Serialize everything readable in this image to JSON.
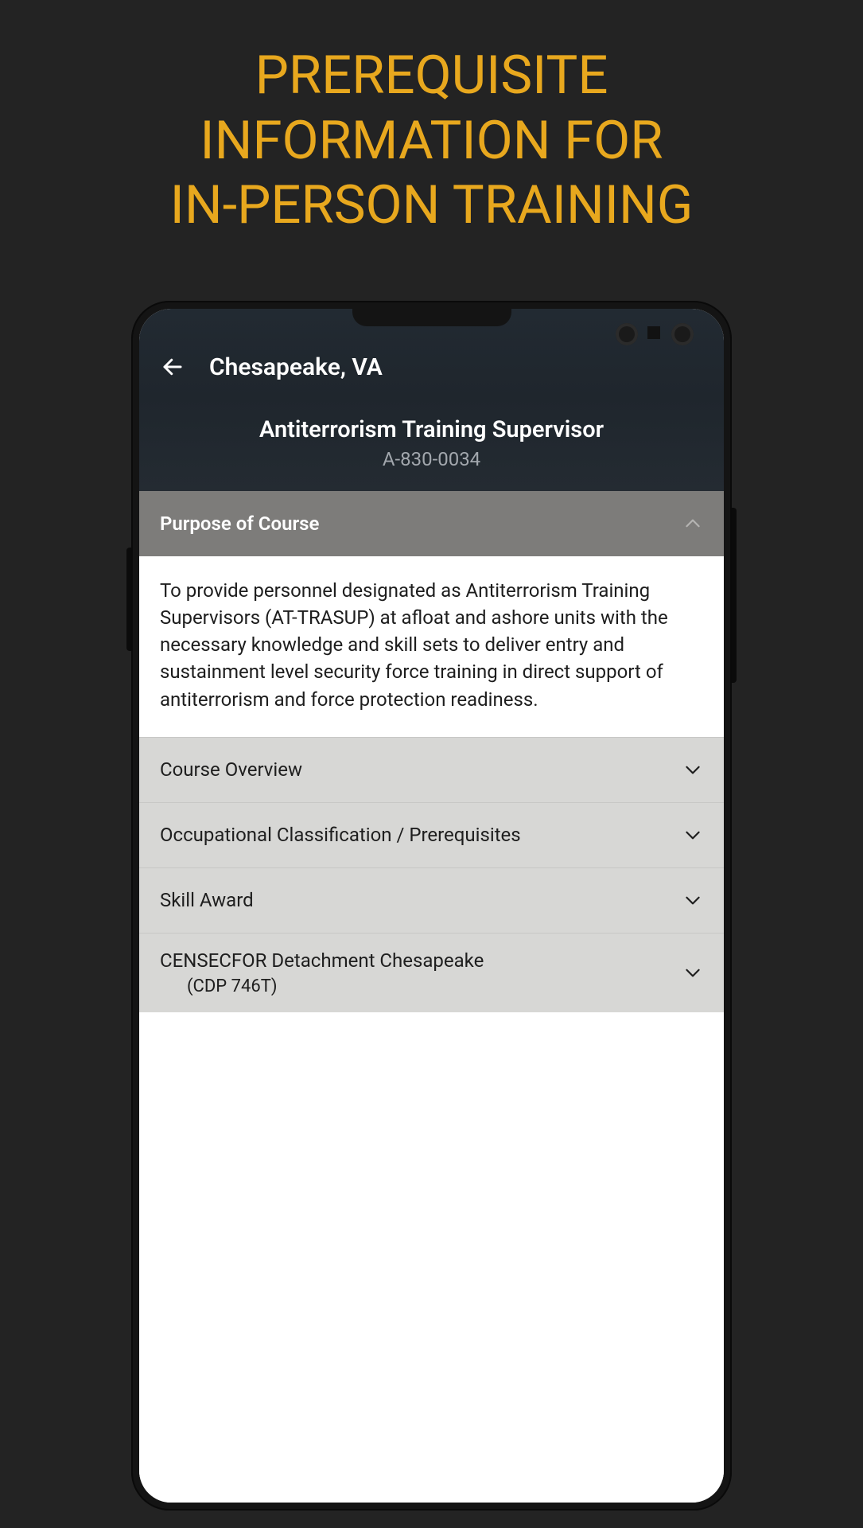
{
  "promo": {
    "line1": "PREREQUISITE",
    "line2": "INFORMATION FOR",
    "line3": "IN-PERSON TRAINING"
  },
  "header": {
    "location": "Chesapeake, VA"
  },
  "course": {
    "title": "Antiterrorism Training Supervisor",
    "code": "A-830-0034"
  },
  "sections": {
    "purpose": {
      "label": "Purpose of Course",
      "expanded": true,
      "body": "To provide personnel designated as Antiterrorism Training Supervisors (AT-TRASUP) at afloat and ashore units with the necessary knowledge and skill sets to deliver entry and sustainment level security force training in direct support of antiterrorism and force protection readiness."
    },
    "overview": {
      "label": "Course Overview"
    },
    "prereq": {
      "label": "Occupational Classification / Prerequisites"
    },
    "skill": {
      "label": "Skill Award"
    },
    "detachment": {
      "label": "CENSECFOR Detachment Chesapeake",
      "sublabel": "(CDP 746T)"
    }
  }
}
